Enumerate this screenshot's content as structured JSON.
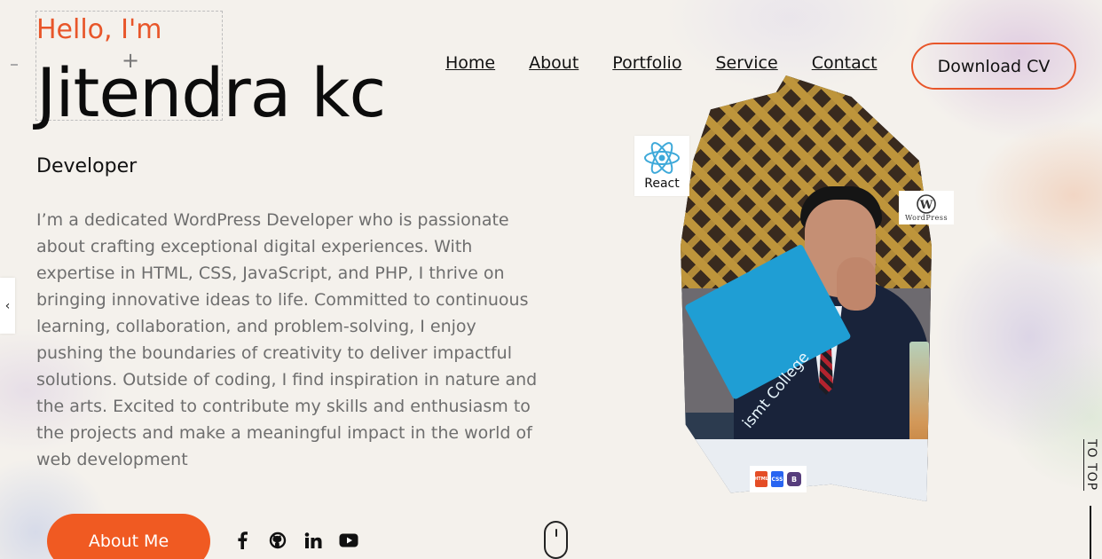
{
  "hero": {
    "greeting": "Hello, I'm",
    "name": "Jitendra kc",
    "role": "Developer",
    "bio": "I’m a dedicated  WordPress Developer who is passionate about crafting exceptional digital experiences. With expertise in HTML, CSS, JavaScript, and PHP, I thrive on bringing innovative ideas to life. Committed to continuous learning, collaboration, and problem-solving, I enjoy pushing the boundaries of creativity to deliver impactful solutions. Outside of coding, I find inspiration in nature and the arts. Excited to contribute my skills and enthusiasm to  the projects and make a meaningful impact in the world of  web development",
    "about_button": "About Me"
  },
  "nav": {
    "items": [
      {
        "label": "Home"
      },
      {
        "label": "About"
      },
      {
        "label": "Portfolio"
      },
      {
        "label": "Service"
      },
      {
        "label": "Contact"
      }
    ],
    "cv_button": "Download CV"
  },
  "badges": {
    "react_label": "React",
    "wordpress_label": "WordPress",
    "stack_labels": [
      "HTML",
      "CSS",
      "B"
    ]
  },
  "photo": {
    "folder_text": "ismt College"
  },
  "side": {
    "prev_arrow": "‹",
    "to_top": "TO TOP"
  },
  "socials": [
    "facebook-icon",
    "github-icon",
    "linkedin-icon",
    "youtube-icon"
  ],
  "colors": {
    "accent": "#f05a22",
    "greeting": "#e8562a",
    "text": "#111111",
    "muted": "#6e6e6e"
  }
}
